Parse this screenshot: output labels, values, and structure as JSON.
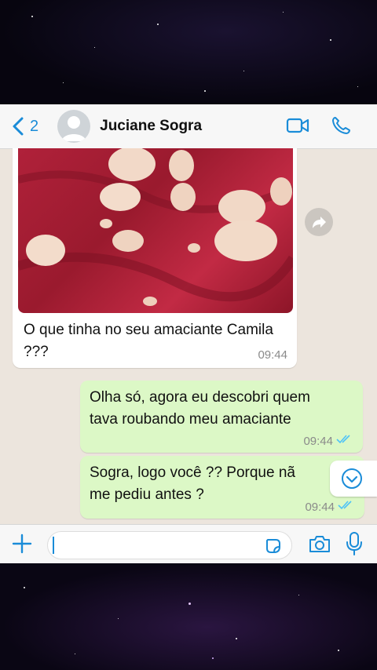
{
  "header": {
    "back_count": "2",
    "contact_name": "Juciane Sogra",
    "icons": [
      "back-chevron-icon",
      "video-call-icon",
      "phone-call-icon"
    ]
  },
  "messages": [
    {
      "direction": "in",
      "type": "image-with-caption",
      "text": "O que tinha no seu amaciante Camila ???",
      "time": "09:44"
    },
    {
      "direction": "out",
      "text_line1": "Olha só, agora eu descobri quem",
      "text_line2": "tava roubando meu amaciante",
      "time": "09:44",
      "status": "read"
    },
    {
      "direction": "out",
      "text_line1": "Sogra, logo você ?? Porque nã",
      "text_line2": "me pediu antes ?",
      "time": "09:44",
      "status": "read"
    }
  ],
  "input_bar": {
    "placeholder": "",
    "icons": [
      "plus-icon",
      "sticker-icon",
      "camera-icon",
      "microphone-icon"
    ]
  },
  "colors": {
    "accent": "#1a8cd8",
    "incoming_bubble": "#ffffff",
    "outgoing_bubble": "#dcf8c6",
    "chat_background": "#ece5dd",
    "read_ticks": "#4fc3f7"
  }
}
